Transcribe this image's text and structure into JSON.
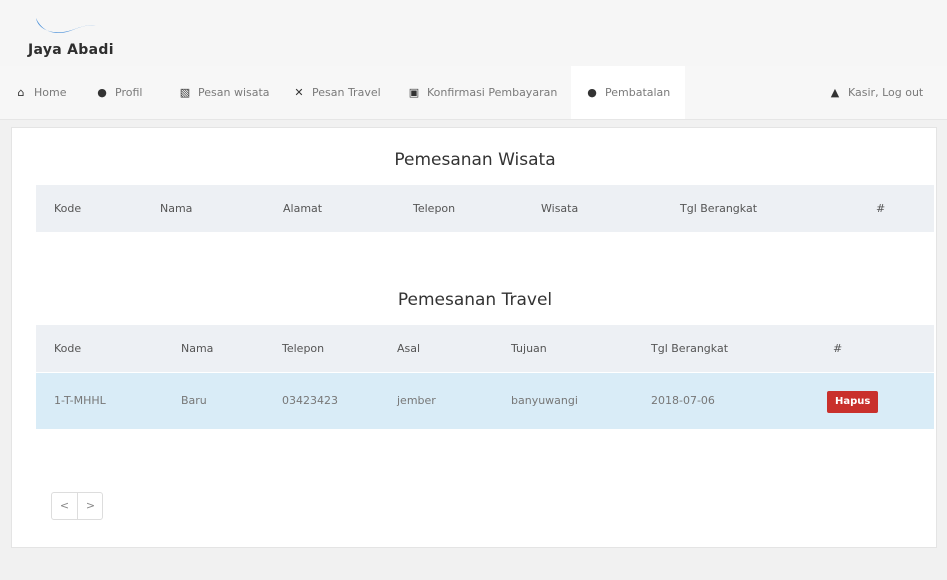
{
  "brand": {
    "name": "Jaya Abadi",
    "accent": "#4a90d9"
  },
  "nav": {
    "items": [
      {
        "icon": "home-icon",
        "label": "Home"
      },
      {
        "icon": "user-icon",
        "label": "Profil"
      },
      {
        "icon": "map-icon",
        "label": "Pesan wisata"
      },
      {
        "icon": "plane-icon",
        "label": "Pesan Travel"
      },
      {
        "icon": "money-icon",
        "label": "Konfirmasi Pembayaran"
      },
      {
        "icon": "user-remove-icon",
        "label": "Pembatalan"
      }
    ],
    "active": "Pembatalan",
    "logout": {
      "icon": "unlock-icon",
      "label": "Kasir, Log out"
    }
  },
  "wisata": {
    "title": "Pemesanan Wisata",
    "columns": [
      "Kode",
      "Nama",
      "Alamat",
      "Telepon",
      "Wisata",
      "Tgl Berangkat",
      "#"
    ],
    "rows": []
  },
  "travel": {
    "title": "Pemesanan Travel",
    "columns": [
      "Kode",
      "Nama",
      "Telepon",
      "Asal",
      "Tujuan",
      "Tgl Berangkat",
      "#"
    ],
    "rows": [
      {
        "kode": "1-T-MHHL",
        "nama": "Baru",
        "telepon": "03423423",
        "asal": "jember",
        "tujuan": "banyuwangi",
        "tgl": "2018-07-06",
        "action": "Hapus"
      }
    ]
  },
  "pager": {
    "prev": "<",
    "next": ">"
  },
  "colors": {
    "delete": "#c9302c",
    "row_highlight": "#d9ecf7",
    "header_bg": "#edf0f4"
  }
}
